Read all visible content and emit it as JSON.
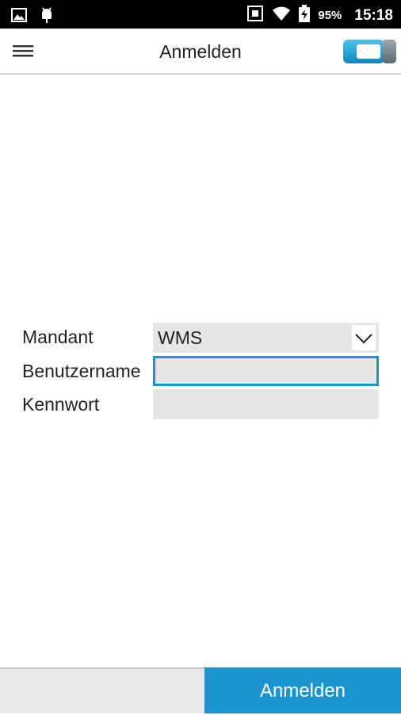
{
  "status_bar": {
    "battery_percent": "95%",
    "time": "15:18",
    "icons": [
      "image-icon",
      "android-debug-icon",
      "nfc-icon",
      "wifi-icon",
      "battery-charging-icon"
    ]
  },
  "app_bar": {
    "title": "Anmelden",
    "menu_icon": "hamburger-menu-icon",
    "logo_icon": "app-logo-icon"
  },
  "form": {
    "mandant": {
      "label": "Mandant",
      "value": "WMS"
    },
    "username": {
      "label": "Benutzername",
      "value": ""
    },
    "password": {
      "label": "Kennwort",
      "value": ""
    }
  },
  "bottom_bar": {
    "login_label": "Anmelden"
  },
  "colors": {
    "accent": "#1a95cf",
    "field_bg": "#e6e6e6"
  }
}
